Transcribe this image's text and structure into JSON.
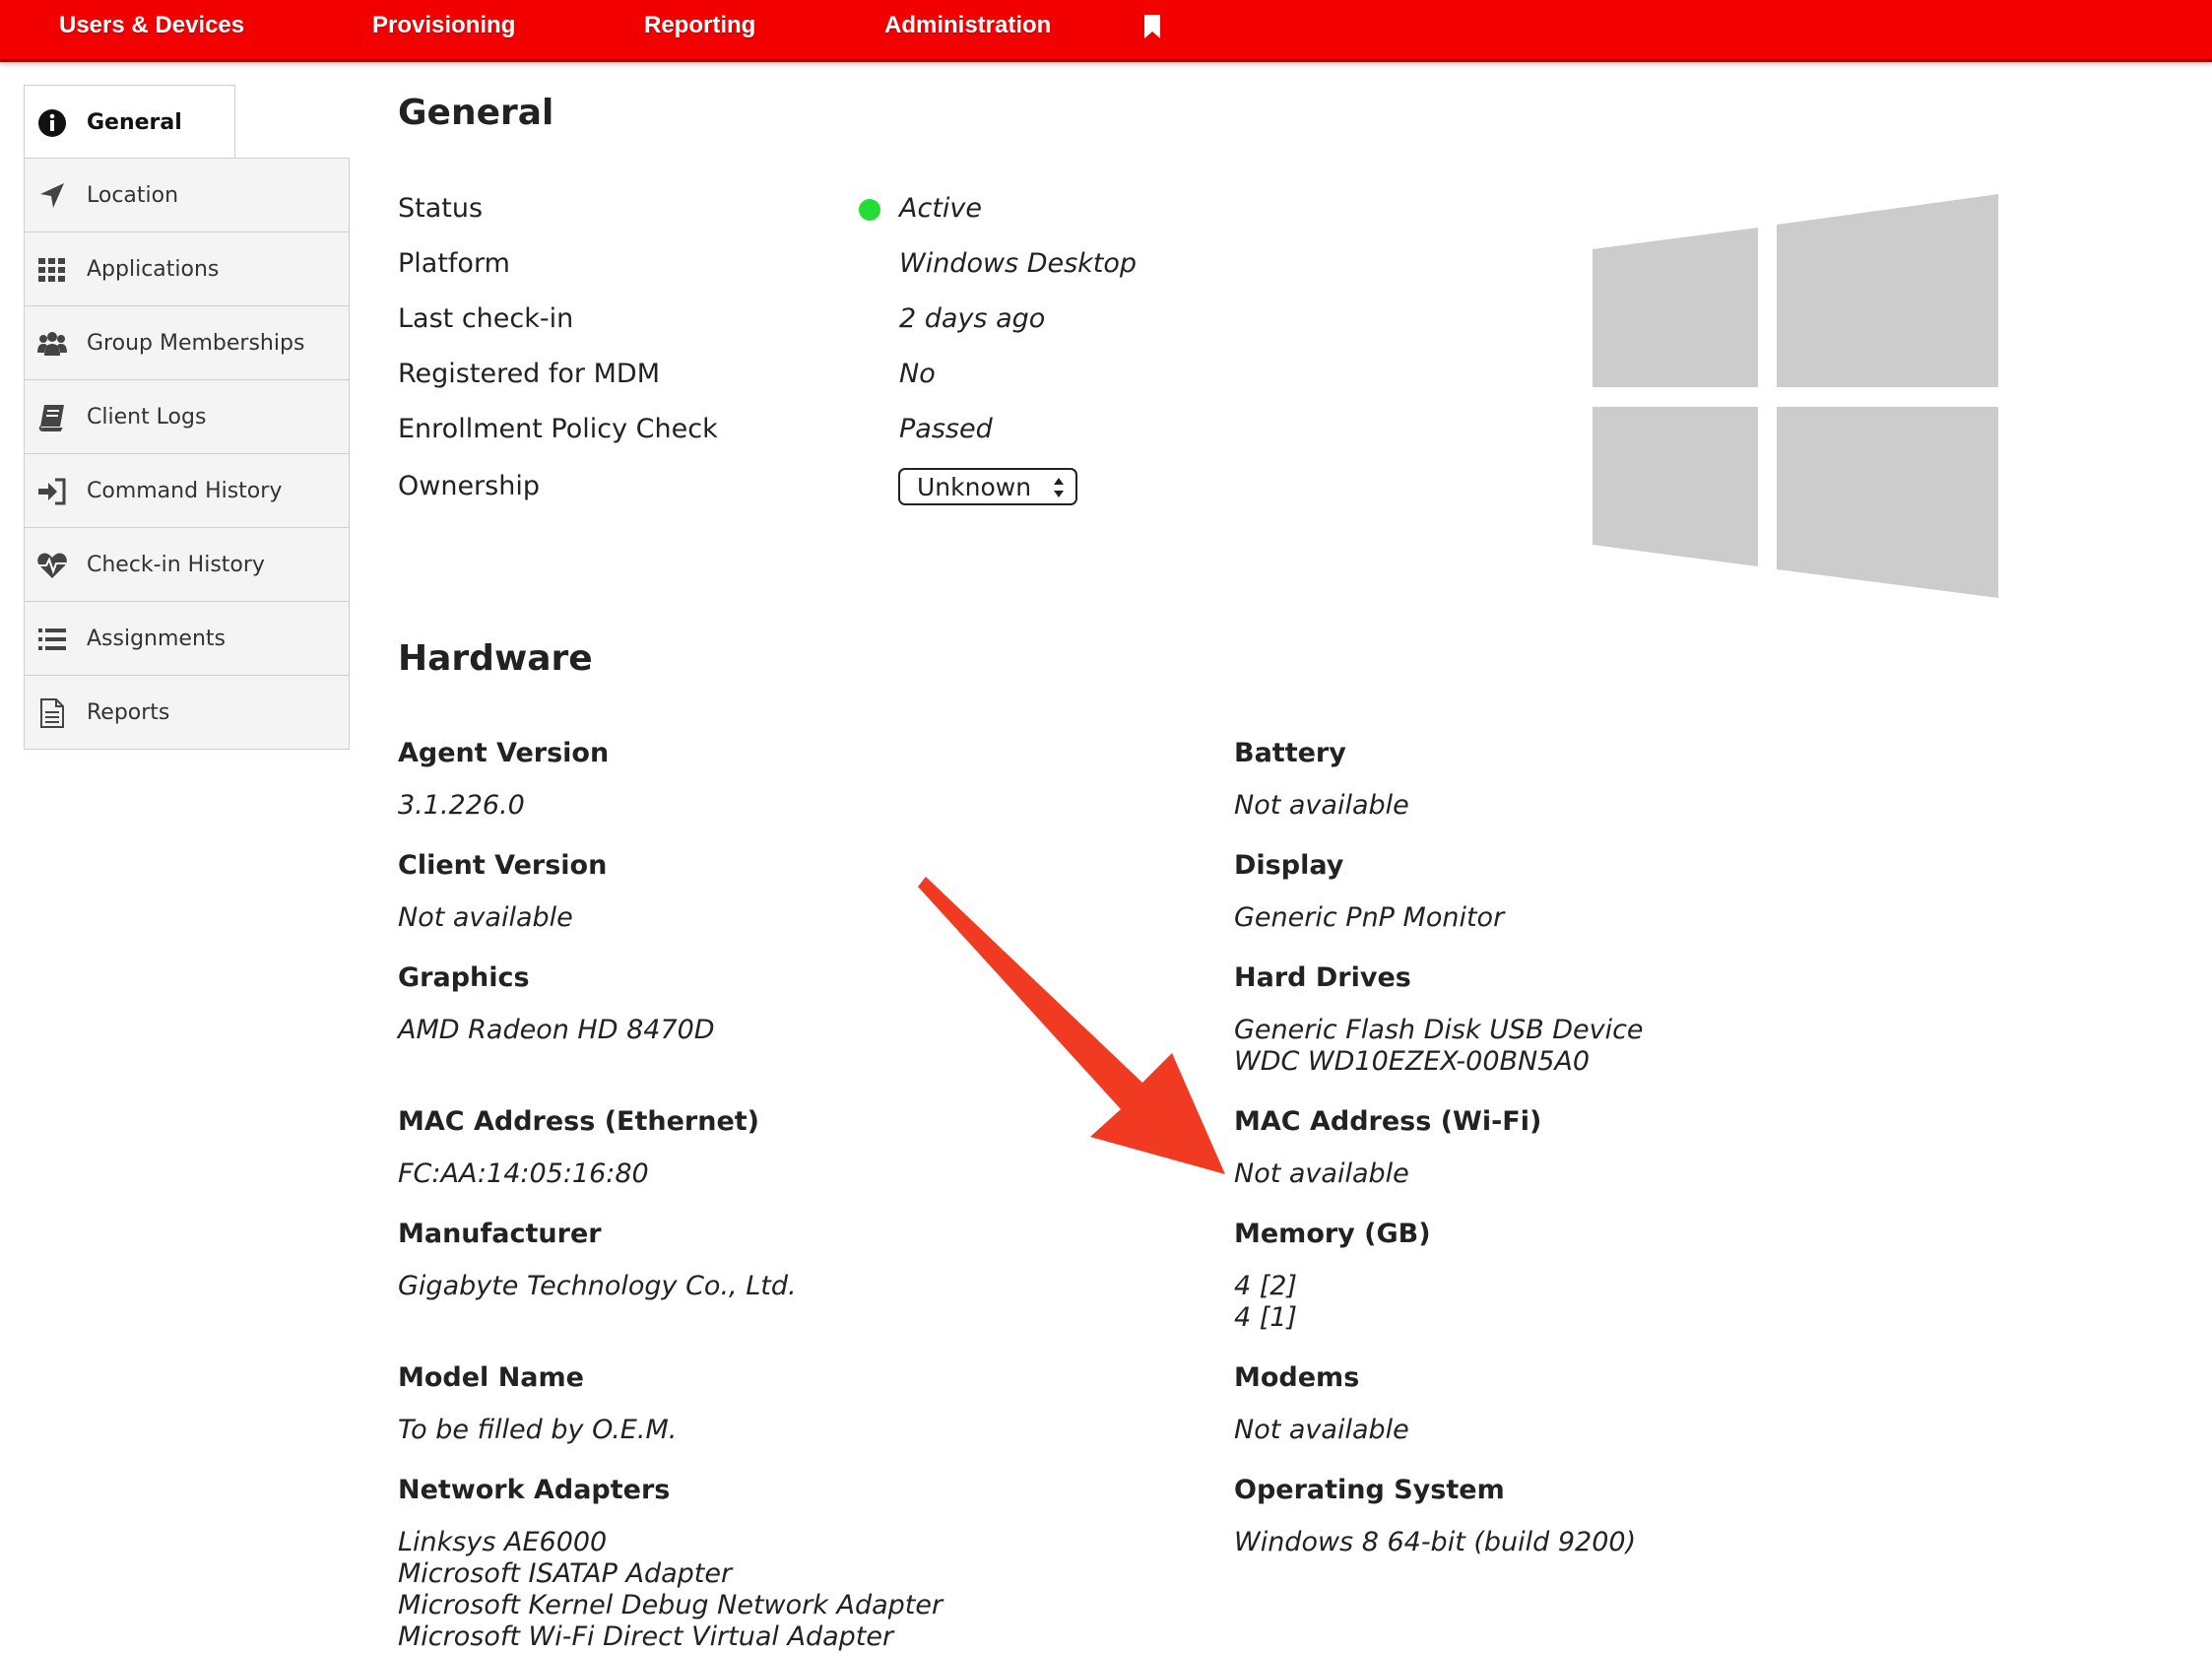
{
  "nav": {
    "items": [
      "Users & Devices",
      "Provisioning",
      "Reporting",
      "Administration"
    ],
    "bookmark_icon": "bookmark-icon"
  },
  "sidebar": {
    "items": [
      {
        "label": "General",
        "icon": "info-icon",
        "active": true
      },
      {
        "label": "Location",
        "icon": "location-arrow-icon"
      },
      {
        "label": "Applications",
        "icon": "grid-icon"
      },
      {
        "label": "Group Memberships",
        "icon": "users-icon"
      },
      {
        "label": "Client Logs",
        "icon": "book-icon"
      },
      {
        "label": "Command History",
        "icon": "sign-in-icon"
      },
      {
        "label": "Check-in History",
        "icon": "heartbeat-icon"
      },
      {
        "label": "Assignments",
        "icon": "list-icon"
      },
      {
        "label": "Reports",
        "icon": "document-icon"
      }
    ]
  },
  "general": {
    "title": "General",
    "rows": [
      {
        "label": "Status",
        "value": "Active"
      },
      {
        "label": "Platform",
        "value": "Windows Desktop"
      },
      {
        "label": "Last check-in",
        "value": "2 days ago"
      },
      {
        "label": "Registered for MDM",
        "value": "No"
      },
      {
        "label": "Enrollment Policy Check",
        "value": "Passed"
      },
      {
        "label": "Ownership",
        "value": "Unknown"
      }
    ],
    "status_color": "#22dd33",
    "platform_logo": "windows-logo-icon"
  },
  "hardware": {
    "title": "Hardware",
    "left": [
      {
        "label": "Agent Version",
        "value": "3.1.226.0"
      },
      {
        "label": "Client Version",
        "value": "Not available"
      },
      {
        "label": "Graphics",
        "value": "AMD Radeon HD 8470D"
      },
      {
        "label": "MAC Address (Ethernet)",
        "value": "FC:AA:14:05:16:80"
      },
      {
        "label": "Manufacturer",
        "value": "Gigabyte Technology Co., Ltd."
      },
      {
        "label": "Model Name",
        "value": "To be filled by O.E.M."
      },
      {
        "label": "Network Adapters",
        "value": "Linksys AE6000\nMicrosoft ISATAP Adapter\nMicrosoft Kernel Debug Network Adapter\nMicrosoft Wi-Fi Direct Virtual Adapter"
      }
    ],
    "right": [
      {
        "label": "Battery",
        "value": "Not available"
      },
      {
        "label": "Display",
        "value": "Generic PnP Monitor"
      },
      {
        "label": "Hard Drives",
        "value": "Generic Flash Disk USB Device\nWDC WD10EZEX-00BN5A0"
      },
      {
        "label": "MAC Address (Wi-Fi)",
        "value": "Not available"
      },
      {
        "label": "Memory (GB)",
        "value": "4 [2]\n4 [1]"
      },
      {
        "label": "Modems",
        "value": "Not available"
      },
      {
        "label": "Operating System",
        "value": "Windows 8 64-bit (build 9200)"
      }
    ]
  },
  "colors": {
    "nav_bg": "#f20000",
    "annotation_arrow": "#f03a21"
  }
}
